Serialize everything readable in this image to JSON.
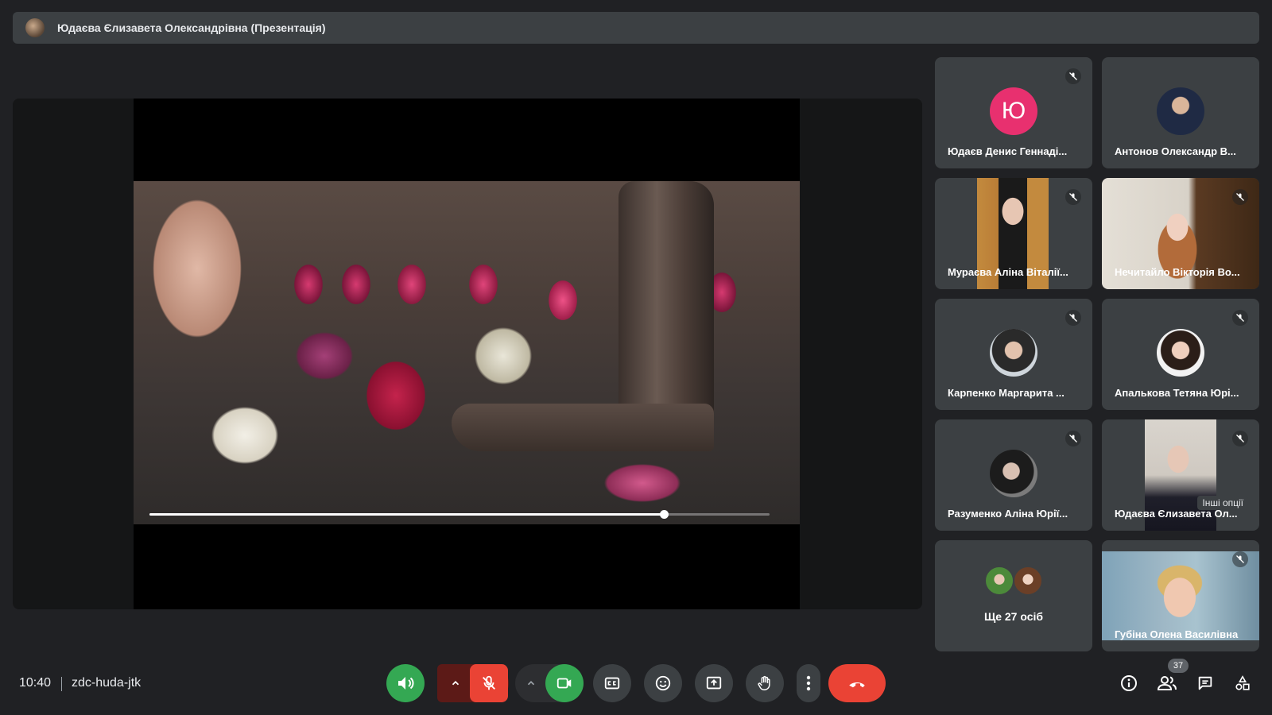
{
  "presenter": {
    "name": "Юдаєва Єлизавета Олександрівна (Презентація)"
  },
  "video": {
    "progress_fraction": 0.83
  },
  "participants": [
    {
      "name": "Юдаєв Денис Геннаді...",
      "initial": "Ю",
      "avatar_color": "#e8306f",
      "muted": true
    },
    {
      "name": "Антонов Олександр В...",
      "muted": false
    },
    {
      "name": "Мураєва Аліна Віталії...",
      "muted": true
    },
    {
      "name": "Нечитайло Вікторія Во...",
      "muted": true
    },
    {
      "name": "Карпенко Маргарита ...",
      "muted": true
    },
    {
      "name": "Апалькова Тетяна Юрі...",
      "muted": true
    },
    {
      "name": "Разуменко Аліна Юрії...",
      "muted": true
    },
    {
      "name": "Юдаєва Єлизавета Ол...",
      "muted": true,
      "tooltip": "Інші опції"
    },
    {
      "more_label": "Ще 27 осіб"
    },
    {
      "name": "Губіна Олена Василівна",
      "muted": true
    }
  ],
  "bottom_bar": {
    "time": "10:40",
    "meeting_code": "zdc-huda-jtk",
    "participants_count": "37",
    "colors": {
      "audio_active": "#34a853",
      "mic_off": "#ea4335",
      "mic_off_dark": "#5c1a17",
      "camera": "#34a853",
      "end_call": "#ea4335"
    }
  },
  "icons": [
    "volume-icon",
    "chevron-up-icon",
    "mic-off-icon",
    "camera-icon",
    "captions-icon",
    "emoji-icon",
    "present-icon",
    "hand-icon",
    "more-vert-icon",
    "call-end-icon",
    "info-icon",
    "people-icon",
    "chat-icon",
    "activities-icon"
  ]
}
